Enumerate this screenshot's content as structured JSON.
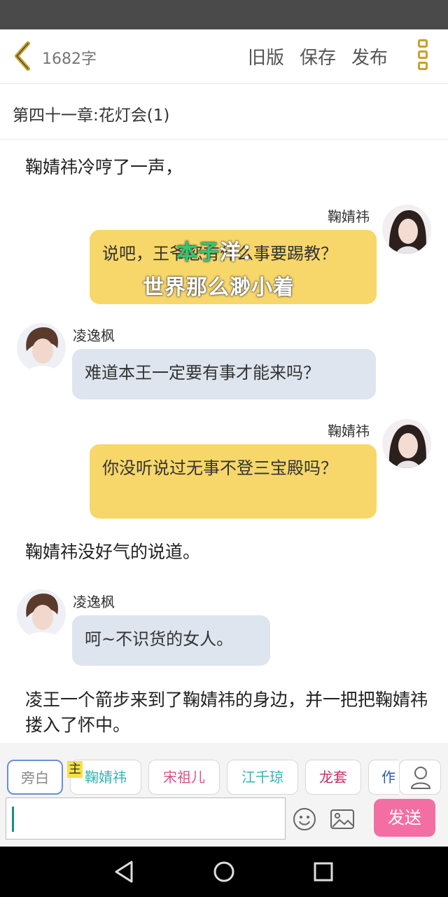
{
  "header": {
    "word_count": "1682字",
    "actions": [
      "旧版",
      "保存",
      "发布"
    ]
  },
  "chapter": {
    "title": "第四十一章:花灯会(1)"
  },
  "chat": {
    "narration_1": "鞠婧祎冷哼了一声，",
    "msg_1": {
      "speaker": "鞠婧祎",
      "text": "说吧，王爷您有什么事要踢教？",
      "overlay_prefix": "本子",
      "overlay_suffix": "洋：",
      "overlay_line2": "世界那么渺小着"
    },
    "msg_2": {
      "speaker": "凌逸枫",
      "text": "难道本王一定要有事才能来吗？"
    },
    "msg_3": {
      "speaker": "鞠婧祎",
      "text": "你没听说过无事不登三宝殿吗？"
    },
    "narration_2": "鞠婧祎没好气的说道。",
    "msg_4": {
      "speaker": "凌逸枫",
      "text": "呵~不识货的女人。"
    },
    "narration_3": "凌王一个箭步来到了鞠婧祎的身边，并一把把鞠婧祎搂入了怀中。"
  },
  "roles": {
    "chips": [
      {
        "label": "旁白",
        "color": "#888888"
      },
      {
        "label": "鞠婧祎",
        "color": "#35b3b3"
      },
      {
        "label": "宋祖儿",
        "color": "#e0508a"
      },
      {
        "label": "江千琼",
        "color": "#35b3b3"
      },
      {
        "label": "龙套",
        "color": "#c0306a"
      },
      {
        "label": "作",
        "color": "#2a5aa8"
      }
    ],
    "host_badge": "主"
  },
  "composer": {
    "input_value": "",
    "send_label": "发送"
  },
  "icons": {
    "back": "chevron-left-icon",
    "more": "more-vertical-icon",
    "profile": "user-icon",
    "emoji": "emoji-icon",
    "image": "image-icon",
    "nav_back": "triangle-back-icon",
    "nav_home": "circle-home-icon",
    "nav_recent": "square-recent-icon"
  },
  "colors": {
    "accent": "#c9a227",
    "yellow_bubble": "#f7d76a",
    "gray_bubble": "#dfe5ee",
    "send": "#f36fa3"
  }
}
